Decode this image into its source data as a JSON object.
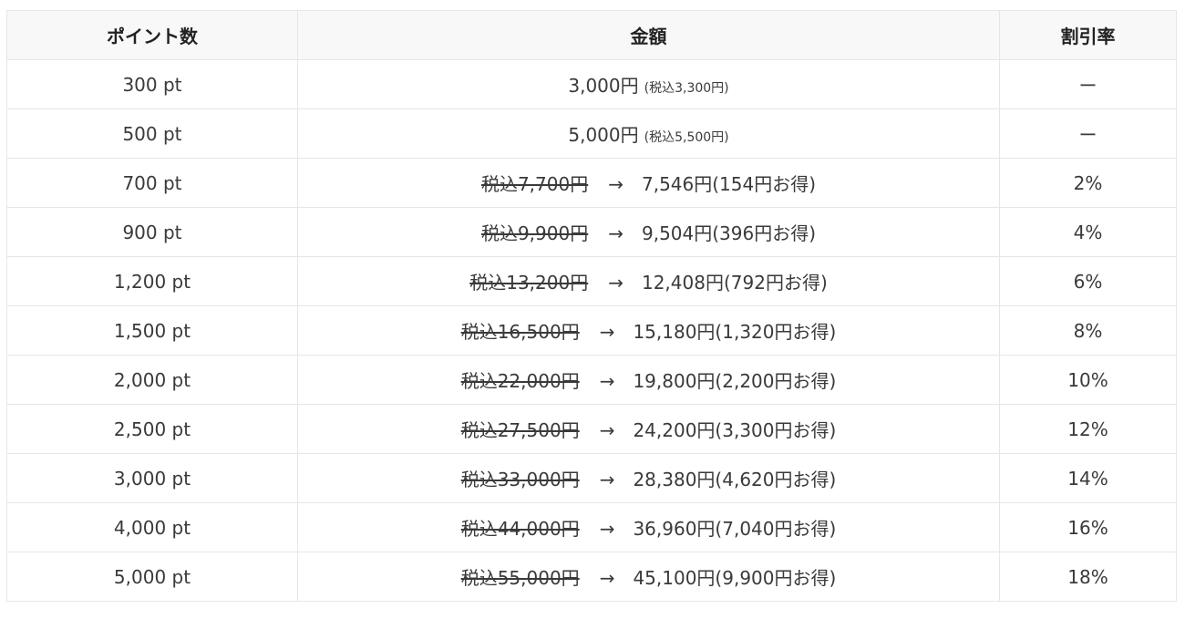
{
  "table": {
    "headers": {
      "points": "ポイント数",
      "price": "金額",
      "rate": "割引率"
    },
    "rows": [
      {
        "points": "300 pt",
        "price": "3,000円",
        "tax_note": "(税込3,300円)",
        "rate": "ー"
      },
      {
        "points": "500 pt",
        "price": "5,000円",
        "tax_note": "(税込5,500円)",
        "rate": "ー"
      },
      {
        "points": "700 pt",
        "original": "税込7,700円",
        "arrow": "→",
        "discounted": "7,546円(154円お得)",
        "rate": "2%"
      },
      {
        "points": "900 pt",
        "original": "税込9,900円",
        "arrow": "→",
        "discounted": "9,504円(396円お得)",
        "rate": "4%"
      },
      {
        "points": "1,200 pt",
        "original": "税込13,200円",
        "arrow": "→",
        "discounted": "12,408円(792円お得)",
        "rate": "6%"
      },
      {
        "points": "1,500 pt",
        "original": "税込16,500円",
        "arrow": "→",
        "discounted": "15,180円(1,320円お得)",
        "rate": "8%"
      },
      {
        "points": "2,000 pt",
        "original": "税込22,000円",
        "arrow": "→",
        "discounted": "19,800円(2,200円お得)",
        "rate": "10%"
      },
      {
        "points": "2,500 pt",
        "original": "税込27,500円",
        "arrow": "→",
        "discounted": "24,200円(3,300円お得)",
        "rate": "12%"
      },
      {
        "points": "3,000 pt",
        "original": "税込33,000円",
        "arrow": "→",
        "discounted": "28,380円(4,620円お得)",
        "rate": "14%"
      },
      {
        "points": "4,000 pt",
        "original": "税込44,000円",
        "arrow": "→",
        "discounted": "36,960円(7,040円お得)",
        "rate": "16%"
      },
      {
        "points": "5,000 pt",
        "original": "税込55,000円",
        "arrow": "→",
        "discounted": "45,100円(9,900円お得)",
        "rate": "18%"
      }
    ]
  }
}
